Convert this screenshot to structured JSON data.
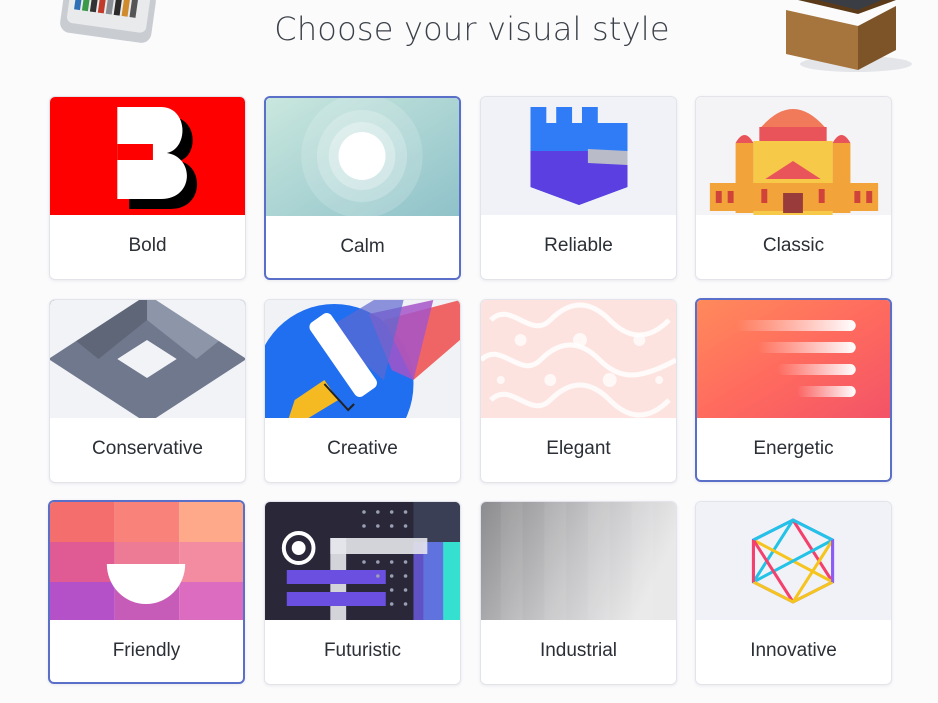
{
  "page": {
    "title": "Choose your visual style"
  },
  "styles": [
    {
      "label": "Bold",
      "selected": false
    },
    {
      "label": "Calm",
      "selected": true
    },
    {
      "label": "Reliable",
      "selected": false
    },
    {
      "label": "Classic",
      "selected": false
    },
    {
      "label": "Conservative",
      "selected": false
    },
    {
      "label": "Creative",
      "selected": false
    },
    {
      "label": "Elegant",
      "selected": false
    },
    {
      "label": "Energetic",
      "selected": true
    },
    {
      "label": "Friendly",
      "selected": true
    },
    {
      "label": "Futuristic",
      "selected": false
    },
    {
      "label": "Industrial",
      "selected": false
    },
    {
      "label": "Innovative",
      "selected": false
    }
  ],
  "colors": {
    "accent": "#5a6fc8",
    "title": "#3c4149",
    "label": "#2b2f36"
  }
}
